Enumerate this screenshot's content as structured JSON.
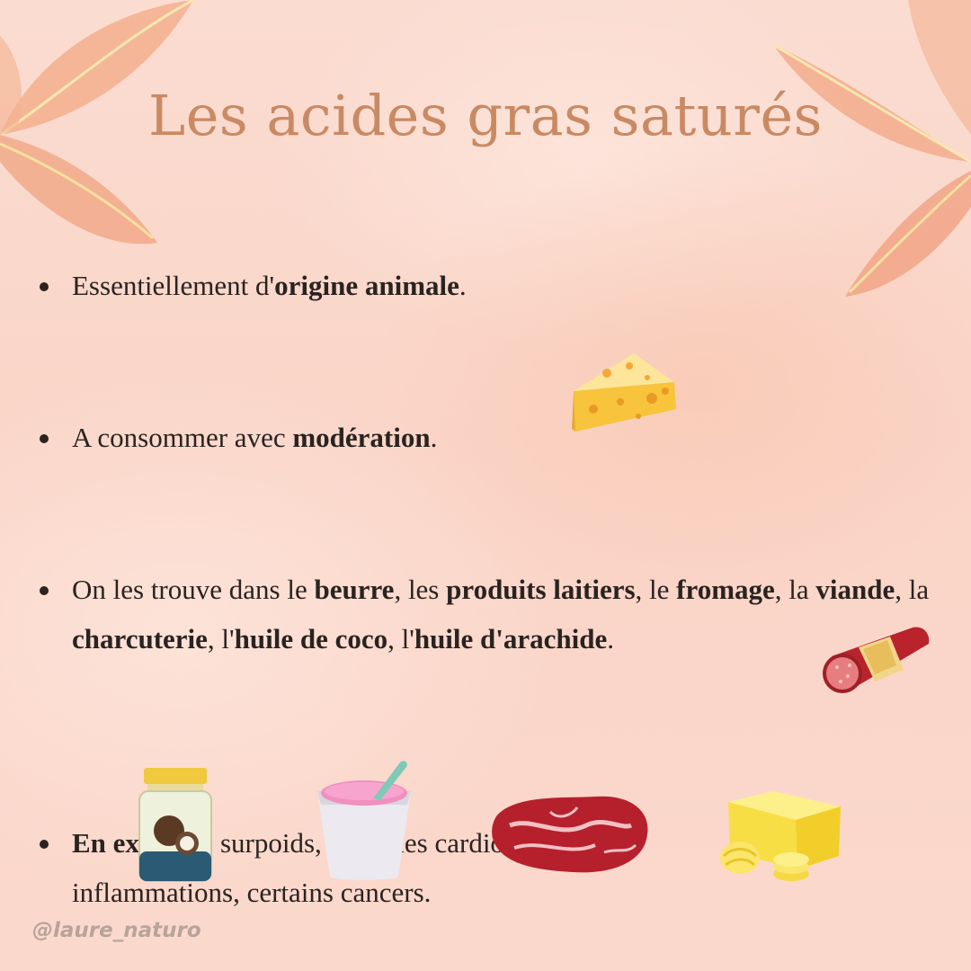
{
  "title": "Les acides gras saturés",
  "bullets": [
    {
      "parts": [
        {
          "t": "Essentiellement d'",
          "b": false
        },
        {
          "t": "origine animale",
          "b": true
        },
        {
          "t": ".",
          "b": false
        }
      ]
    },
    {
      "parts": [
        {
          "t": "A consommer avec ",
          "b": false
        },
        {
          "t": "modération",
          "b": true
        },
        {
          "t": ".",
          "b": false
        }
      ]
    },
    {
      "parts": [
        {
          "t": "On les trouve dans le ",
          "b": false
        },
        {
          "t": "beurre",
          "b": true
        },
        {
          "t": ", les ",
          "b": false
        },
        {
          "t": "produits laitiers",
          "b": true
        },
        {
          "t": ", le ",
          "b": false
        },
        {
          "t": "fromage",
          "b": true
        },
        {
          "t": ", la ",
          "b": false
        },
        {
          "t": "viande",
          "b": true
        },
        {
          "t": ", la ",
          "b": false
        },
        {
          "t": "charcuterie",
          "b": true
        },
        {
          "t": ", l'",
          "b": false
        },
        {
          "t": "huile de coco",
          "b": true
        },
        {
          "t": ", l'",
          "b": false
        },
        {
          "t": "huile d'arachide",
          "b": true
        },
        {
          "t": ".",
          "b": false
        }
      ]
    },
    {
      "parts": [
        {
          "t": "En excès",
          "b": true
        },
        {
          "t": " => surpoids, maladies cardio-vaculaires, inflammations, certains cancers.",
          "b": false
        }
      ]
    }
  ],
  "handle": "@laure_naturo",
  "icons": [
    "cheese-icon",
    "sausage-icon",
    "coconut-oil-jar-icon",
    "yogurt-icon",
    "steak-icon",
    "butter-icon"
  ],
  "colors": {
    "title": "#c98a63",
    "text": "#2a2320",
    "background": "#fbdcd0",
    "leaf": "#f0a27e"
  }
}
